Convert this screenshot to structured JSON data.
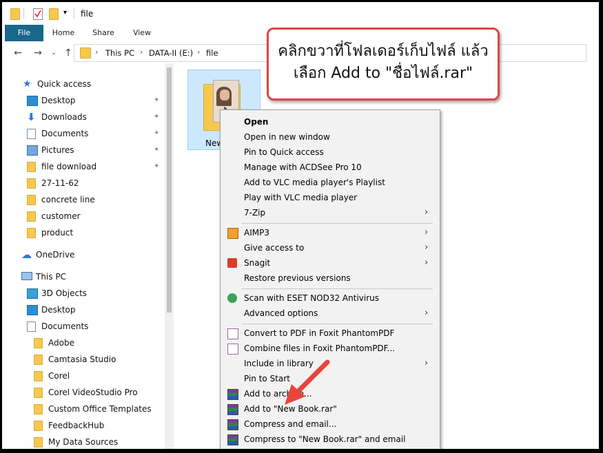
{
  "window": {
    "title": "file"
  },
  "ribbon": {
    "tabs": [
      "File",
      "Home",
      "Share",
      "View"
    ]
  },
  "address": {
    "crumbs": [
      "This PC",
      "DATA-II (E:)",
      "file"
    ]
  },
  "sidebar": {
    "quick_access": "Quick access",
    "items": [
      {
        "label": "Desktop",
        "icon": "desktop-icon",
        "pinned": true
      },
      {
        "label": "Downloads",
        "icon": "download-icon",
        "pinned": true
      },
      {
        "label": "Documents",
        "icon": "documents-icon",
        "pinned": true
      },
      {
        "label": "Pictures",
        "icon": "pictures-icon",
        "pinned": true
      },
      {
        "label": "file download",
        "icon": "folder-icon",
        "pinned": true
      },
      {
        "label": "27-11-62",
        "icon": "folder-icon",
        "pinned": false
      },
      {
        "label": "concrete line",
        "icon": "folder-icon",
        "pinned": false
      },
      {
        "label": "customer",
        "icon": "folder-icon",
        "pinned": false
      },
      {
        "label": "product",
        "icon": "folder-icon",
        "pinned": false
      }
    ],
    "onedrive": "OneDrive",
    "this_pc": "This PC",
    "pc_items": [
      {
        "label": "3D Objects",
        "icon": "cube-icon"
      },
      {
        "label": "Desktop",
        "icon": "desktop-icon"
      },
      {
        "label": "Documents",
        "icon": "documents-icon"
      }
    ],
    "doc_items": [
      "Adobe",
      "Camtasia Studio",
      "Corel",
      "Corel VideoStudio Pro",
      "Custom Office Templates",
      "FeedbackHub",
      "My Data Sources"
    ]
  },
  "content": {
    "folder_label": "New"
  },
  "context_menu": {
    "group1": [
      {
        "label": "Open",
        "bold": true
      },
      {
        "label": "Open in new window"
      },
      {
        "label": "Pin to Quick access"
      },
      {
        "label": "Manage with ACDSee Pro 10"
      },
      {
        "label": "Add to VLC media player's Playlist"
      },
      {
        "label": "Play with VLC media player"
      },
      {
        "label": "7-Zip",
        "submenu": true
      }
    ],
    "group2": [
      {
        "label": "AIMP3",
        "submenu": true,
        "icon": "aimp-icon"
      },
      {
        "label": "Give access to",
        "submenu": true
      },
      {
        "label": "Snagit",
        "submenu": true,
        "icon": "snagit-icon"
      },
      {
        "label": "Restore previous versions"
      }
    ],
    "group3": [
      {
        "label": "Scan with ESET NOD32 Antivirus",
        "icon": "eset-icon"
      },
      {
        "label": "Advanced options",
        "submenu": true
      }
    ],
    "group4": [
      {
        "label": "Convert to PDF in Foxit PhantomPDF",
        "icon": "foxit-icon"
      },
      {
        "label": "Combine files in Foxit PhantomPDF...",
        "icon": "foxit-icon"
      },
      {
        "label": "Include in library",
        "submenu": true
      },
      {
        "label": "Pin to Start"
      },
      {
        "label": "Add to archive...",
        "icon": "winrar-icon"
      },
      {
        "label": "Add to \"New Book.rar\"",
        "icon": "winrar-icon"
      },
      {
        "label": "Compress and email...",
        "icon": "winrar-icon"
      },
      {
        "label": "Compress to \"New Book.rar\" and email",
        "icon": "winrar-icon"
      }
    ]
  },
  "callout": {
    "line1": "คลิกขวาที่โฟลเดอร์เก็บไฟล์ แล้ว",
    "line2": "เลือก Add to \"ชื่อไฟล์.rar\""
  },
  "colors": {
    "file_tab": "#19678a",
    "selection": "#cce8ff",
    "callout_border": "#e04545",
    "arrow": "#e8453c"
  }
}
